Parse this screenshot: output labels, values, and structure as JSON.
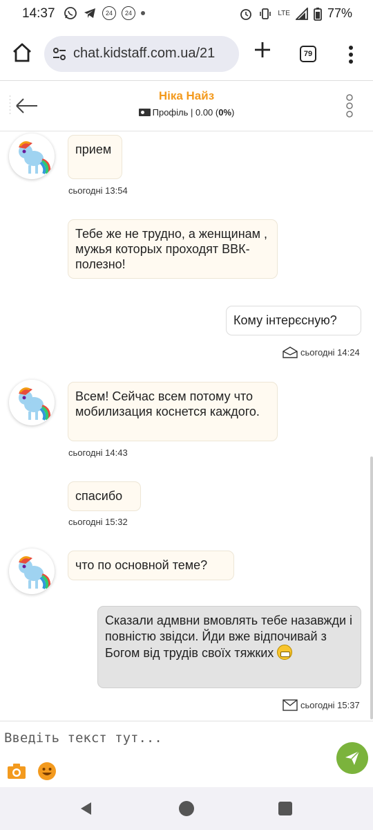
{
  "status_bar": {
    "time": "14:37",
    "network": "LTE",
    "battery": "77%",
    "notification_badges": [
      "24",
      "24"
    ],
    "icons": [
      "whatsapp-icon",
      "telegram-icon",
      "alarm-icon",
      "vibrate-icon",
      "signal-icon",
      "battery-icon"
    ]
  },
  "browser": {
    "url": "chat.kidstaff.com.ua/21",
    "tab_count": "79"
  },
  "chat_header": {
    "name": "Ніка Найз",
    "profile_label": "Профіль",
    "rating_prefix": " | 0.00 (",
    "rating_percent": "0%",
    "rating_suffix": ")"
  },
  "messages": [
    {
      "direction": "in",
      "text": "прием",
      "time": "сьогодні 13:54"
    },
    {
      "direction": "in",
      "text": "Тебе же не трудно, а женщинам , мужья которых проходят ВВК-полезно!"
    },
    {
      "direction": "out",
      "text": "Кому інтерєсную?",
      "time": "сьогодні 14:24"
    },
    {
      "direction": "in",
      "text": "Всем! Сейчас всем потому что мобилизация коснется каждого.",
      "time": "сьогодні 14:43"
    },
    {
      "direction": "in",
      "text": "спасибо",
      "time": "сьогодні 15:32"
    },
    {
      "direction": "in",
      "text": "что по основной теме?"
    },
    {
      "direction": "out",
      "text": "Сказали адмвни вмовлять тебе назавжди і повністю звідси. Йди вже відпочивай з Богом від трудів своїх тяжких",
      "time": "сьогодні 15:37"
    }
  ],
  "composer": {
    "placeholder": "Введіть текст тут..."
  },
  "colors": {
    "accent_name": "#f39a1e",
    "send_button": "#7bb33c",
    "incoming_bubble": "#fffaf1",
    "outgoing_bubble_gray": "#e3e3e3"
  }
}
